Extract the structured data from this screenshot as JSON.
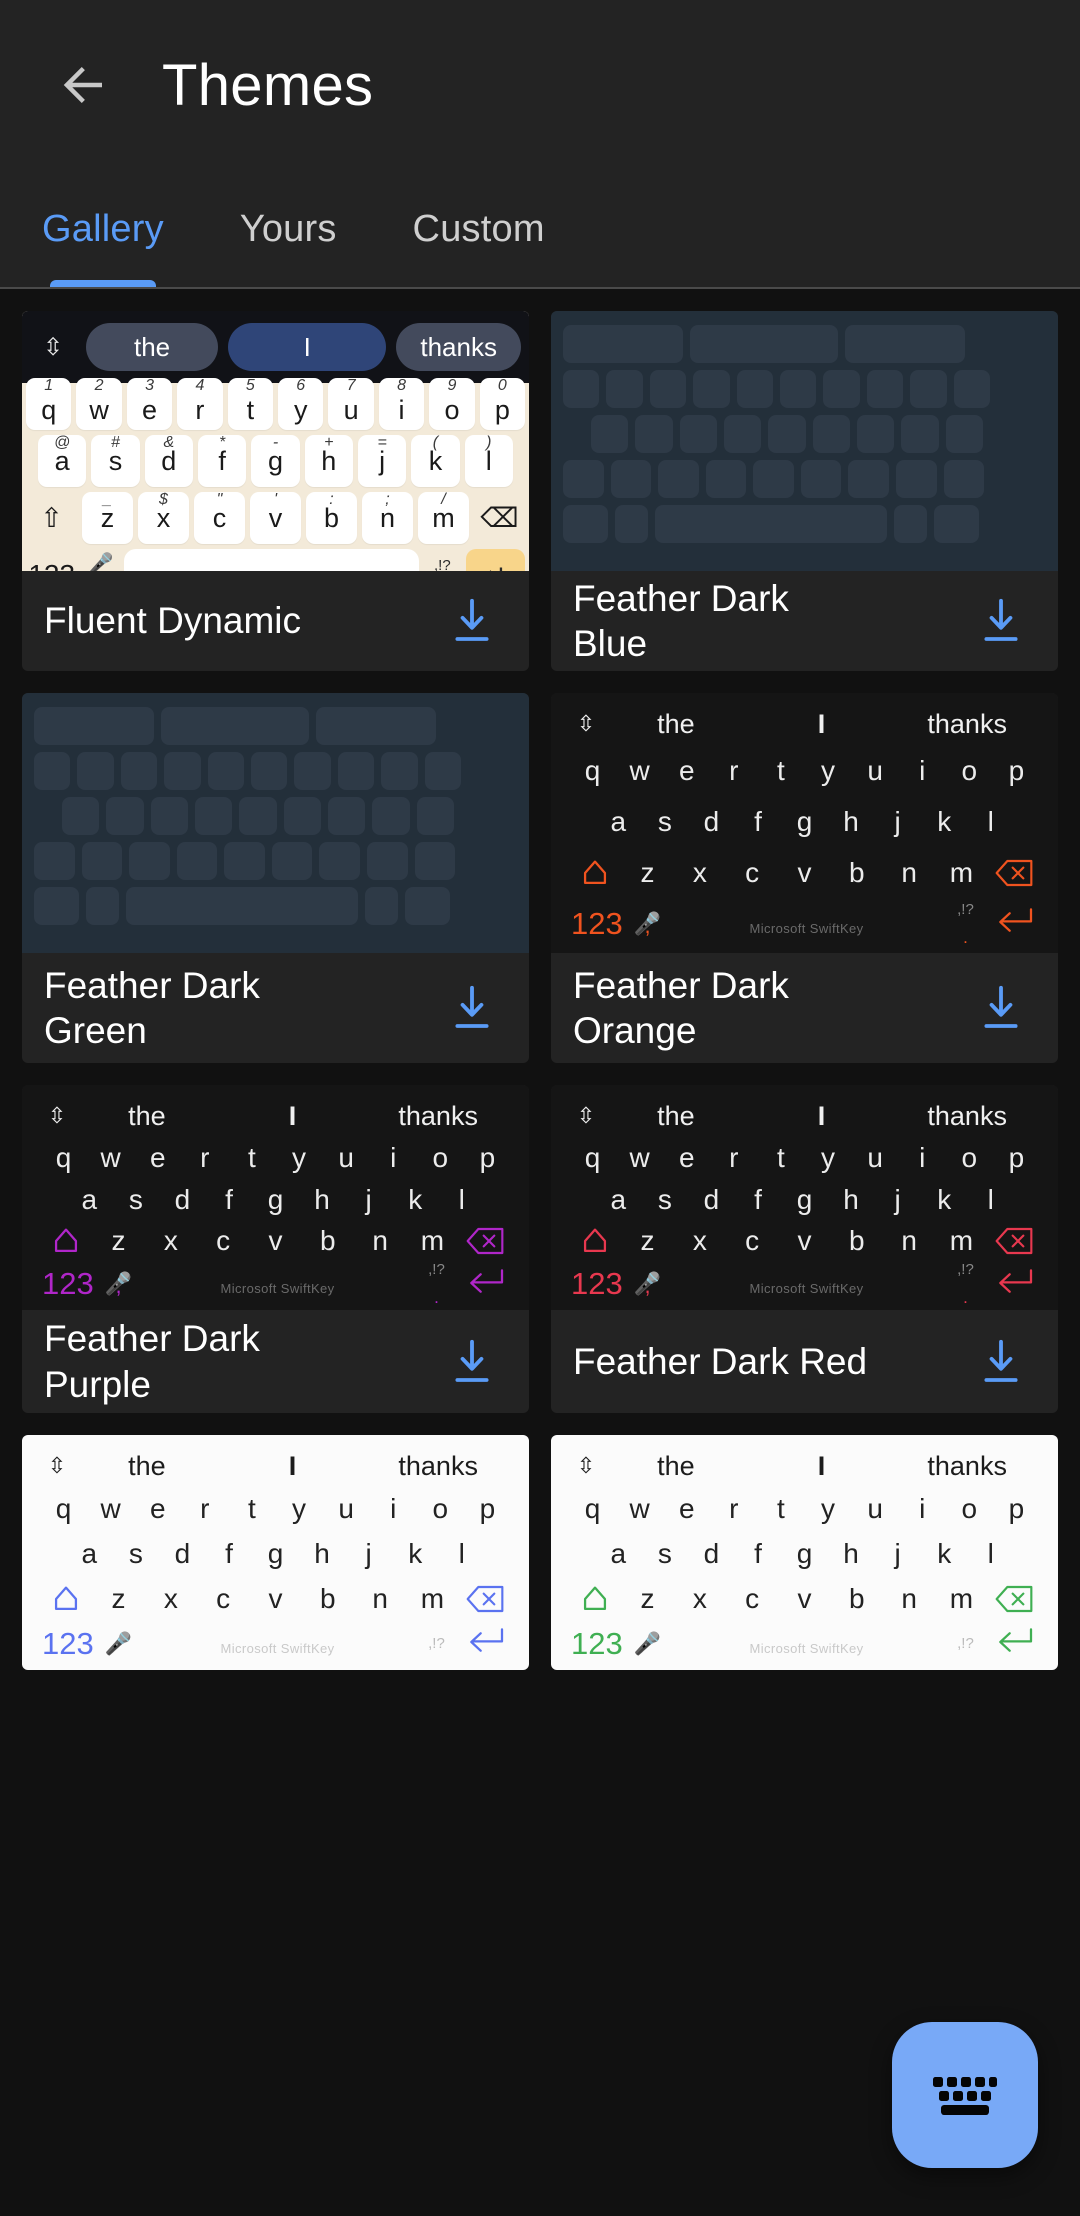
{
  "appbar": {
    "back_icon": "arrow-left-icon",
    "title": "Themes"
  },
  "tabs": {
    "active_index": 0,
    "items": [
      {
        "label": "Gallery"
      },
      {
        "label": "Yours"
      },
      {
        "label": "Custom"
      }
    ]
  },
  "accent_colors": {
    "tab_active": "#5a9bf6",
    "download_icon": "#5a9bf6",
    "fab_background": "#78a9f7",
    "fab_icon": "#000000"
  },
  "keyboard_preview": {
    "suggestions": [
      "the",
      "I",
      "thanks"
    ],
    "row1": [
      "q",
      "w",
      "e",
      "r",
      "t",
      "y",
      "u",
      "i",
      "o",
      "p"
    ],
    "row1_numbers": [
      "1",
      "2",
      "3",
      "4",
      "5",
      "6",
      "7",
      "8",
      "9",
      "0"
    ],
    "row2": [
      "a",
      "s",
      "d",
      "f",
      "g",
      "h",
      "j",
      "k",
      "l"
    ],
    "row2_symbols": [
      "@",
      "#",
      "&",
      "*",
      "-",
      "+",
      "=",
      "(",
      ")"
    ],
    "row3": [
      "z",
      "x",
      "c",
      "v",
      "b",
      "n",
      "m"
    ],
    "row3_symbols": [
      "_",
      "$",
      "\"",
      "'",
      ":",
      ";",
      "/"
    ],
    "numeric_key": "123",
    "mic_icon": "microphone-icon",
    "comma_key": ",",
    "punctuation_top": ",!?",
    "punctuation_bottom": ".",
    "shift_icon": "shift-icon",
    "backspace_icon": "backspace-icon",
    "enter_icon": "enter-icon",
    "watermark": "Microsoft SwiftKey",
    "expand_icon": "expand-collapse-icon"
  },
  "themes": [
    {
      "name": "Fluent Dynamic",
      "preview_style": "fluent",
      "download_label": "download-icon"
    },
    {
      "name": "Feather Dark Blue",
      "preview_style": "skeleton",
      "download_label": "download-icon"
    },
    {
      "name": "Feather Dark Green",
      "preview_style": "skeleton",
      "download_label": "download-icon"
    },
    {
      "name": "Feather Dark Orange",
      "preview_style": "feather-dark",
      "accent": "#F0531F",
      "download_label": "download-icon"
    },
    {
      "name": "Feather Dark Purple",
      "preview_style": "feather-dark",
      "accent": "#B026C9",
      "download_label": "download-icon"
    },
    {
      "name": "Feather Dark Red",
      "preview_style": "feather-dark",
      "accent": "#E8384F",
      "download_label": "download-icon"
    },
    {
      "name": "",
      "preview_style": "feather-light",
      "accent": "#5A72F0",
      "download_label": "download-icon"
    },
    {
      "name": "",
      "preview_style": "feather-light",
      "accent": "#3FAF52",
      "download_label": "download-icon"
    }
  ],
  "fab": {
    "icon": "keyboard-icon"
  }
}
